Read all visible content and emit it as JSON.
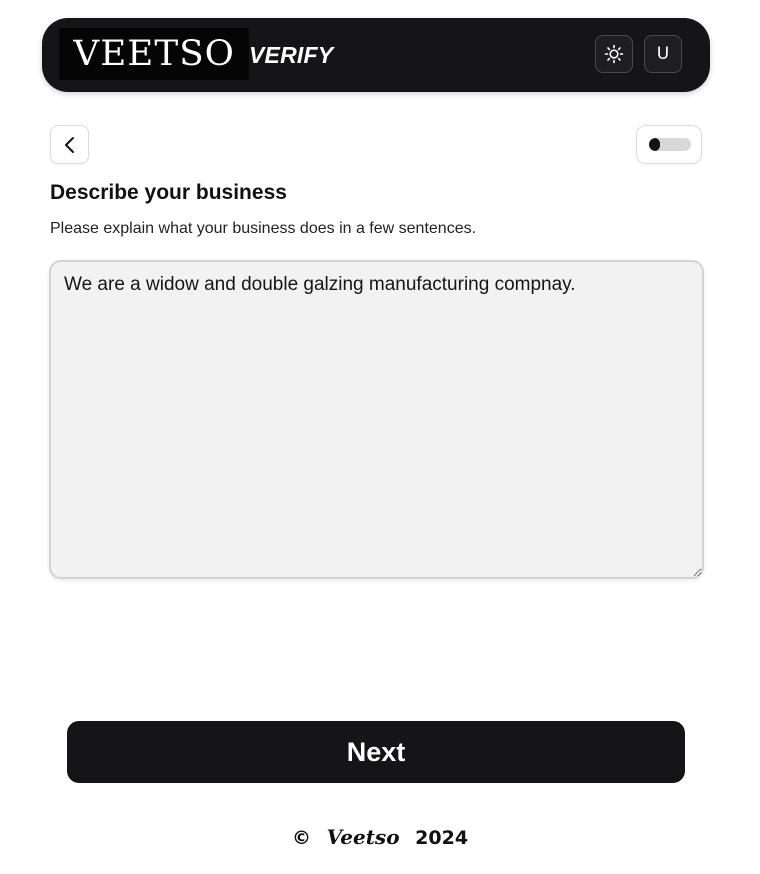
{
  "header": {
    "logo_text": "VEETSO",
    "product_text": "VERIFY",
    "theme_icon": "sun-icon",
    "user_initial": "U"
  },
  "nav": {
    "back_icon": "chevron-left-icon"
  },
  "progress": {
    "value": 0.25
  },
  "form": {
    "title": "Describe your business",
    "subtitle": "Please explain what your business does in a few sentences.",
    "description_value": "We are a widow and double galzing manufacturing compnay."
  },
  "actions": {
    "next_label": "Next"
  },
  "footer": {
    "copyright_symbol": "©",
    "brand": "Veetso",
    "year": "2024"
  },
  "colors": {
    "header_bg": "#151517",
    "button_bg": "#151517",
    "textarea_bg": "#f2f2f2",
    "progress_fill": "#141414",
    "progress_track": "#d8d8d8"
  }
}
